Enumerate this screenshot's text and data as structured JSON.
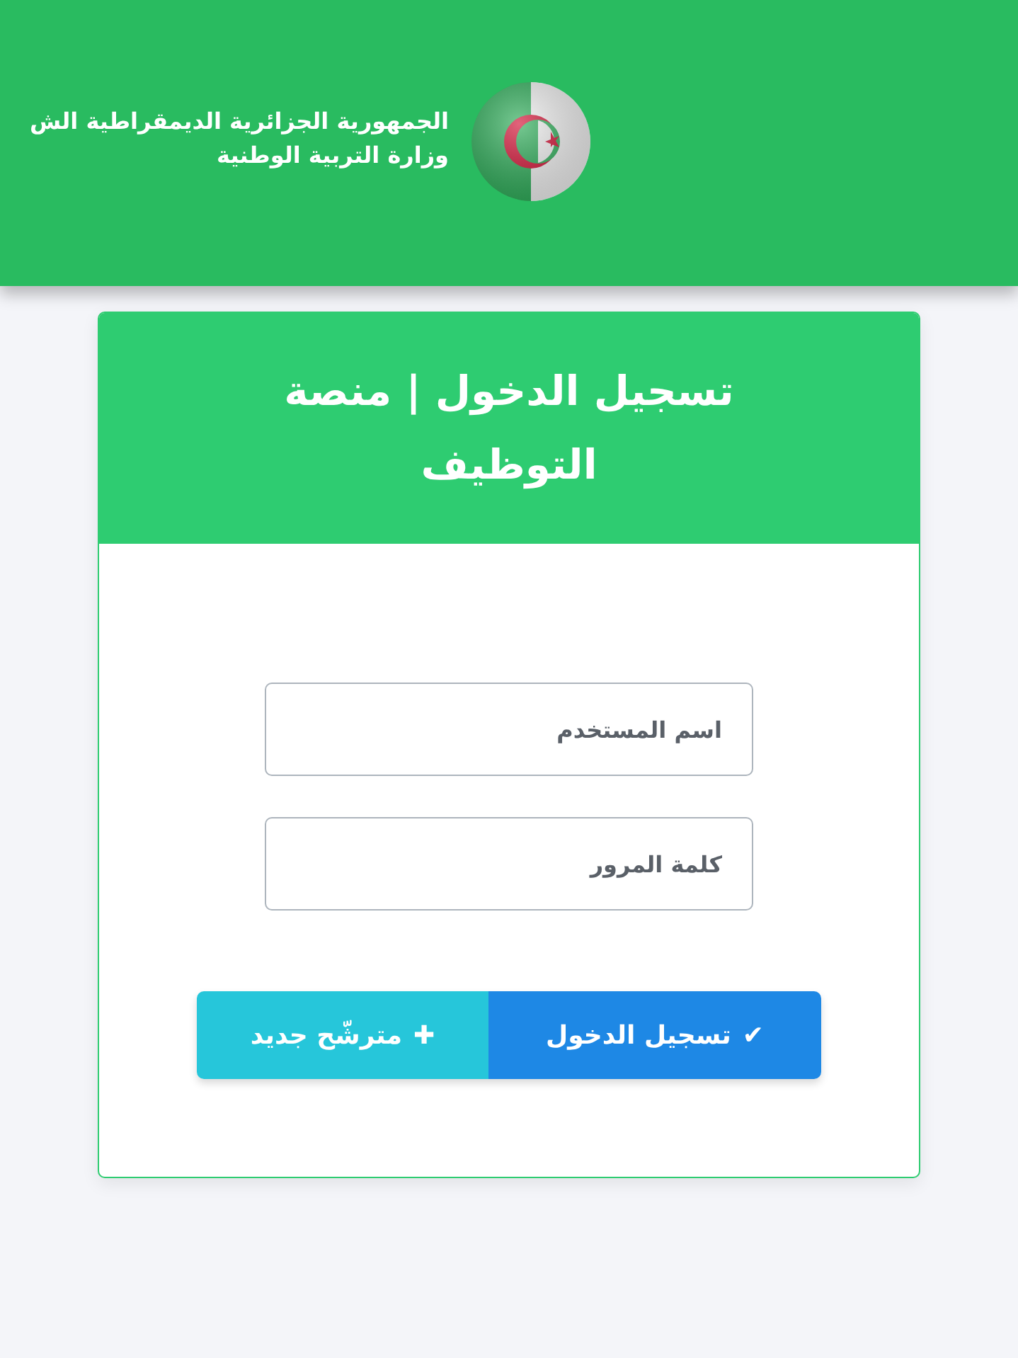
{
  "header": {
    "line_1": "الجمهورية الجزائرية الديمقراطية الش",
    "line_2": "وزارة التربية الوطنية"
  },
  "card": {
    "title": "تسجيل الدخول | منصة التوظيف"
  },
  "fields": [
    {
      "placeholder": "اسم المستخدم"
    },
    {
      "placeholder": "كلمة المرور"
    }
  ],
  "buttons": [
    {
      "kind": "login",
      "icon": "✔",
      "label": "تسجيل الدخول"
    },
    {
      "kind": "register",
      "icon": "✚",
      "label": "مترشّح جديد"
    }
  ]
}
